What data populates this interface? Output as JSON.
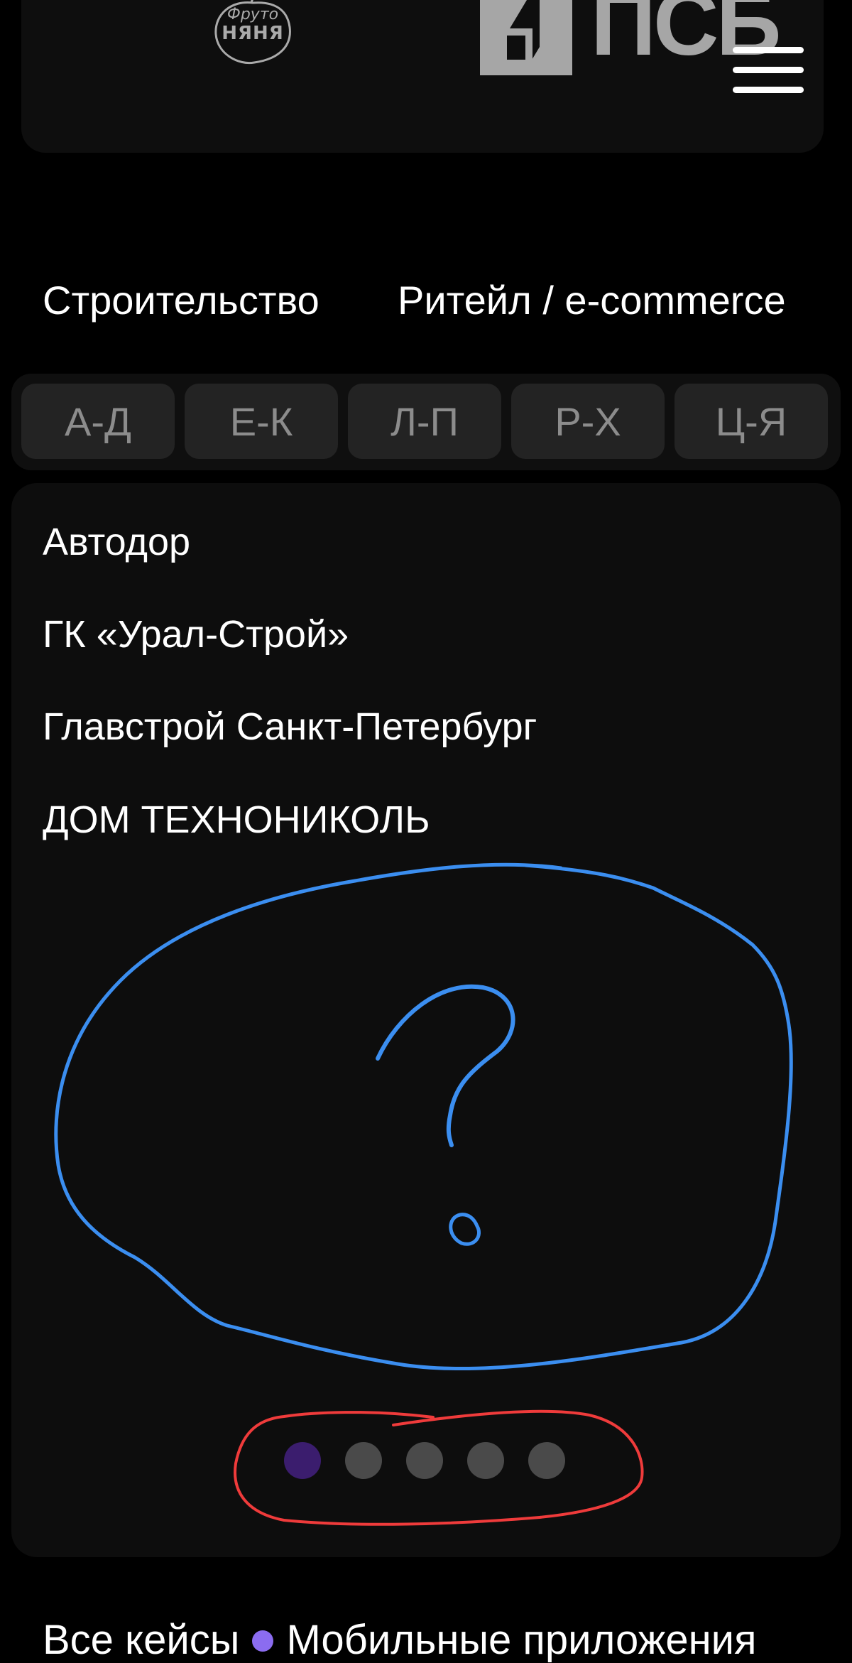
{
  "header": {
    "client_logos": [
      "Фруто Няня",
      "ПСБ"
    ],
    "fruto_logo": {
      "line1": "Фруто",
      "line2": "НЯНЯ"
    },
    "psb_logo_text": "ПСБ",
    "menu_icon": "hamburger-menu-icon"
  },
  "industry_tabs": [
    "Строительство",
    "Ритейл / e-commerce"
  ],
  "alphabet_filter": [
    "А-Д",
    "Е-К",
    "Л-П",
    "Р-Х",
    "Ц-Я"
  ],
  "companies": [
    "Автодор",
    "ГК «Урал-Строй»",
    "Главстрой Санкт-Петербург",
    "ДОМ ТЕХНОНИКОЛЬ"
  ],
  "pagination": {
    "total": 5,
    "active_index": 0
  },
  "annotations": {
    "question_mark": "?"
  },
  "footer_links": [
    "Все кейсы",
    "Мобильные приложения"
  ],
  "colors": {
    "background": "#000000",
    "card": "#0e0e0e",
    "chip": "#232323",
    "chip_text": "#8c8c8c",
    "active_dot": "#3b1d6e",
    "inactive_dot": "#4a4a4a",
    "accent_purple": "#8b6cf0",
    "annotation_blue": "#3b8ef0",
    "annotation_red": "#ef3b3b"
  }
}
